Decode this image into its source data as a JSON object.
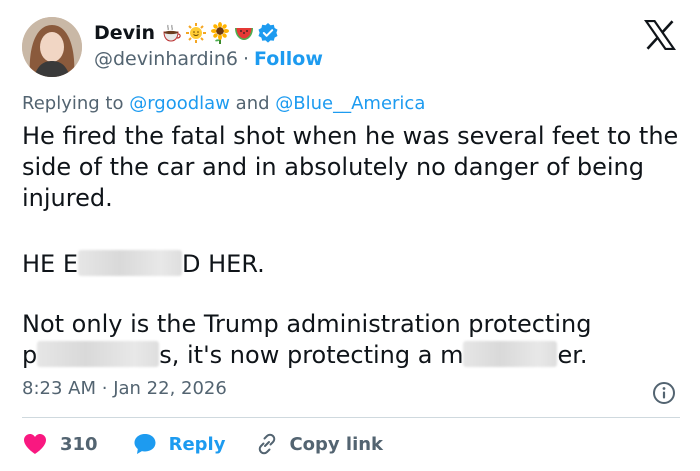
{
  "author": {
    "display_name": "Devin",
    "handle": "@devinhardin6",
    "separator": "·",
    "follow_label": "Follow",
    "badges": [
      "coffee-icon",
      "sun-icon",
      "sunflower-icon",
      "watermelon-icon",
      "verified-badge-icon"
    ],
    "verified_color": "#1d9bf0"
  },
  "reply_context": {
    "prefix": "Replying to",
    "mention_1": "@rgoodlaw",
    "conjunction": "and",
    "mention_2": "@Blue__America"
  },
  "tweet": {
    "paragraph_1": "He fired the fatal shot when he was several feet to the side of the car and in absolutely no danger of being injured.",
    "paragraph_2_start": "HE E",
    "paragraph_2_end": "D HER.",
    "paragraph_3_line_1": "Not only is the Trump administration protecting",
    "paragraph_3_start": "p",
    "paragraph_3_mid": "s, it's now protecting a m",
    "paragraph_3_end": "er."
  },
  "meta": {
    "time": "8:23 AM",
    "separator": "·",
    "date": "Jan 22, 2026"
  },
  "actions": {
    "like_count": "310",
    "reply_label": "Reply",
    "copy_link_label": "Copy link"
  },
  "colors": {
    "like": "#f91880",
    "link": "#1d9bf0",
    "muted": "#536471",
    "text": "#0f1419"
  }
}
